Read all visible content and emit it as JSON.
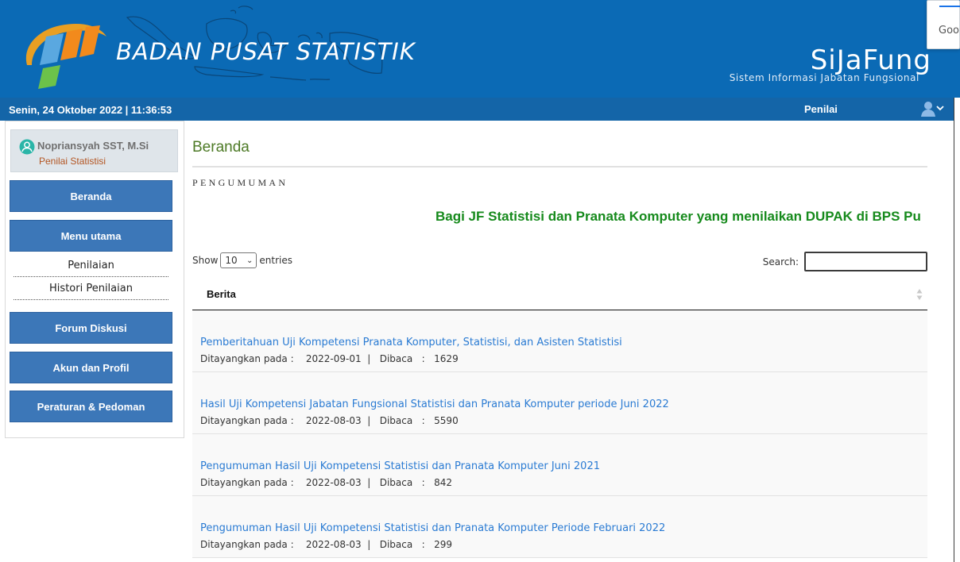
{
  "header": {
    "org_name": "BADAN PUSAT STATISTIK",
    "app_name": "SiJaFung",
    "app_subtitle": "Sistem Informasi Jabatan Fungsional",
    "google_popup_text": "Goo"
  },
  "status_bar": {
    "datetime": "Senin, 24 Oktober 2022 | 11:36:53",
    "role": "Penilai",
    "user_icon": "user-icon"
  },
  "sidebar": {
    "user": {
      "name": "Nopriansyah SST, M.Si",
      "role": "Penilai Statistisi"
    },
    "items": [
      {
        "label": "Beranda"
      },
      {
        "label": "Menu utama"
      },
      {
        "label": "Forum Diskusi"
      },
      {
        "label": "Akun dan Profil"
      },
      {
        "label": "Peraturan & Pedoman"
      }
    ],
    "submenu": [
      {
        "label": "Penilaian"
      },
      {
        "label": "Histori Penilaian"
      }
    ]
  },
  "main": {
    "page_title": "Beranda",
    "announcement_label": "PENGUMUMAN",
    "marquee_text": "Bagi JF Statistisi dan Pranata Komputer yang menilaikan DUPAK di BPS Pu",
    "table": {
      "show_label": "Show",
      "entries_value": "10",
      "entries_label": "entries",
      "search_label": "Search:",
      "column_header": "Berita",
      "rows": [
        {
          "title": "Pemberitahuan Uji Kompetensi Pranata Komputer, Statistisi, dan Asisten Statistisi",
          "meta": "Ditayangkan pada :    2022-09-01  |   Dibaca   :   1629"
        },
        {
          "title": "Hasil Uji Kompetensi Jabatan Fungsional Statistisi dan Pranata Komputer periode Juni 2022",
          "meta": "Ditayangkan pada :    2022-08-03  |   Dibaca   :   5590"
        },
        {
          "title": "Pengumuman Hasil Uji Kompetensi Statistisi dan Pranata Komputer Juni 2021",
          "meta": "Ditayangkan pada :    2022-08-03  |   Dibaca   :   842"
        },
        {
          "title": "Pengumuman Hasil Uji Kompetensi Statistisi dan Pranata Komputer Periode Februari 2022",
          "meta": "Ditayangkan pada :    2022-08-03  |   Dibaca   :   299"
        }
      ]
    }
  },
  "colors": {
    "header_blue": "#0b6ab5",
    "status_bar_blue": "#1465a8",
    "nav_button_blue": "#3c77b8",
    "title_green": "#4d7a26",
    "marquee_green": "#168a1c",
    "link_blue": "#2a7bd3",
    "user_role_orange": "#b35522"
  }
}
